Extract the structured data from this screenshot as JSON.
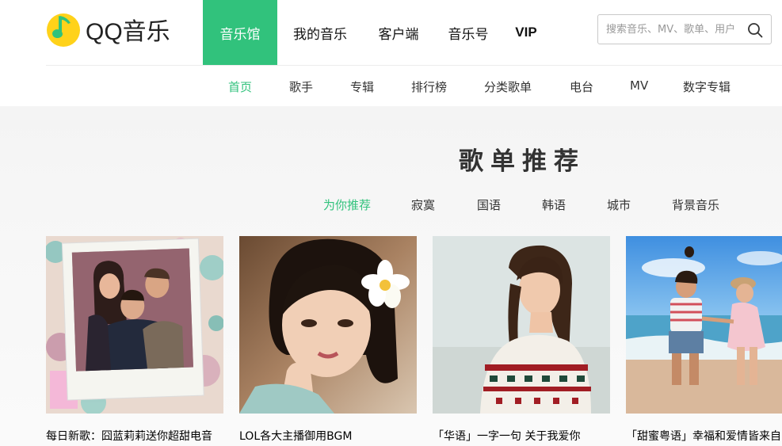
{
  "brand": {
    "logo_text": "QQ音乐"
  },
  "top_nav": [
    "音乐馆",
    "我的音乐",
    "客户端",
    "音乐号",
    "VIP"
  ],
  "search": {
    "placeholder": "搜索音乐、MV、歌单、用户"
  },
  "sub_nav": [
    "首页",
    "歌手",
    "专辑",
    "排行榜",
    "分类歌单",
    "电台",
    "MV",
    "数字专辑"
  ],
  "section": {
    "title": "歌单推荐",
    "tabs": [
      "为你推荐",
      "寂寞",
      "国语",
      "韩语",
      "城市",
      "背景音乐"
    ]
  },
  "playlists": [
    {
      "title": "每日新歌：囧蓝莉莉送你超甜电音"
    },
    {
      "title": "LOL各大主播御用BGM"
    },
    {
      "title": "「华语」一字一句 关于我爱你"
    },
    {
      "title": "「甜蜜粤语」幸福和爱情皆来自"
    }
  ],
  "colors": {
    "accent": "#31c27c",
    "logo_yellow": "#ffd21a"
  },
  "icons": {
    "logo": "qq-music-note-icon",
    "search": "magnifier-icon"
  }
}
